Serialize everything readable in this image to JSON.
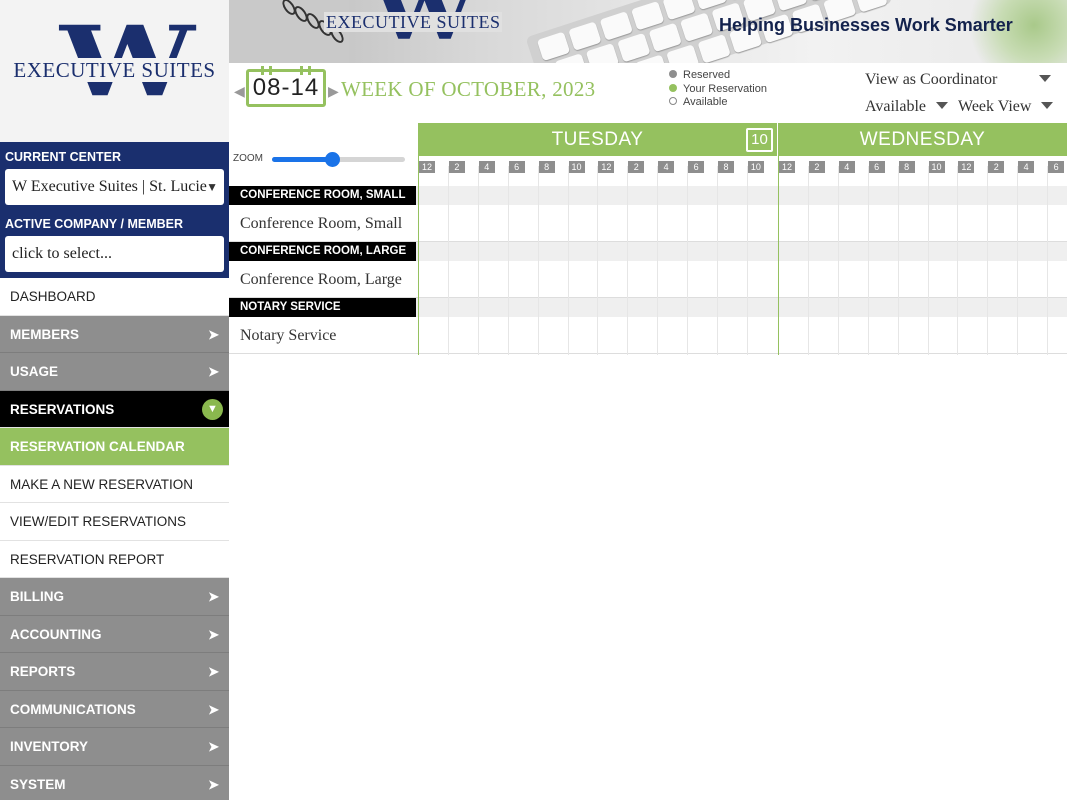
{
  "brand": {
    "logo_letter": "W",
    "logo_name": "EXECUTIVE SUITES",
    "tagline": "Helping Businesses Work Smarter"
  },
  "colors": {
    "navy": "#1a2f6e",
    "green": "#95c15f",
    "gray_nav": "#8e8e8e",
    "black": "#000000"
  },
  "sidebar": {
    "current_center_label": "CURRENT CENTER",
    "current_center_value": "W Executive Suites | St. Lucie",
    "active_company_label": "ACTIVE COMPANY / MEMBER",
    "active_company_value": "click to select...",
    "nav": [
      {
        "label": "DASHBOARD",
        "style": "light",
        "icon": ""
      },
      {
        "label": "MEMBERS",
        "style": "gray",
        "icon": "arrow-right-icon"
      },
      {
        "label": "USAGE",
        "style": "gray",
        "icon": "arrow-right-icon"
      },
      {
        "label": "RESERVATIONS",
        "style": "dark",
        "icon": "chevron-down-circle-icon"
      },
      {
        "label": "RESERVATION CALENDAR",
        "style": "green",
        "icon": ""
      },
      {
        "label": "MAKE A NEW RESERVATION",
        "style": "sub",
        "icon": ""
      },
      {
        "label": "VIEW/EDIT RESERVATIONS",
        "style": "sub",
        "icon": ""
      },
      {
        "label": "RESERVATION REPORT",
        "style": "sub",
        "icon": ""
      },
      {
        "label": "BILLING",
        "style": "gray",
        "icon": "arrow-right-icon"
      },
      {
        "label": "ACCOUNTING",
        "style": "gray",
        "icon": "arrow-right-icon"
      },
      {
        "label": "REPORTS",
        "style": "gray",
        "icon": "arrow-right-icon"
      },
      {
        "label": "COMMUNICATIONS",
        "style": "gray",
        "icon": "arrow-right-icon"
      },
      {
        "label": "INVENTORY",
        "style": "gray",
        "icon": "arrow-right-icon"
      },
      {
        "label": "SYSTEM",
        "style": "gray",
        "icon": "arrow-right-icon"
      }
    ]
  },
  "week": {
    "date_range": "08-14",
    "title": "WEEK OF OCTOBER, 2023",
    "legend": [
      {
        "label": "Reserved",
        "dot": "gray"
      },
      {
        "label": "Your Reservation",
        "dot": "green"
      },
      {
        "label": "Available",
        "dot": "empty"
      }
    ],
    "view_as": "View as Coordinator",
    "filter": "Available",
    "view_mode": "Week View"
  },
  "calendar": {
    "zoom_label": "ZOOM",
    "zoom_level": 0.45,
    "days": [
      {
        "name": "TUESDAY",
        "calendar_icon_day": "10"
      },
      {
        "name": "WEDNESDAY",
        "calendar_icon_day": ""
      }
    ],
    "hours_day1": [
      "12",
      "2",
      "4",
      "6",
      "8",
      "10",
      "12",
      "2",
      "4",
      "6",
      "8",
      "10"
    ],
    "hours_day2": [
      "12",
      "2",
      "4",
      "6",
      "8",
      "10",
      "12",
      "2",
      "4",
      "6"
    ],
    "resources": [
      {
        "category": "CONFERENCE ROOM, SMALL",
        "name": "Conference Room, Small"
      },
      {
        "category": "CONFERENCE ROOM, LARGE",
        "name": "Conference Room, Large"
      },
      {
        "category": "NOTARY SERVICE",
        "name": "Notary Service"
      }
    ]
  }
}
